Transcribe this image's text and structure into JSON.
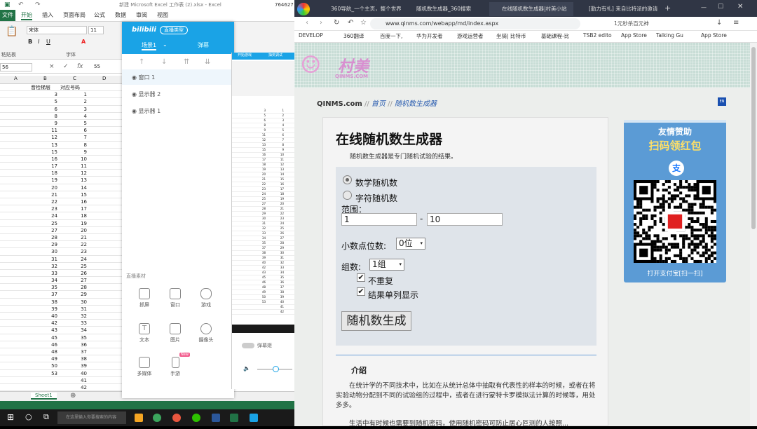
{
  "excel": {
    "title": "新建 Microsoft Excel 工作表 (2).xlsx - Excel",
    "title_right": "764627",
    "tabs": [
      "文件",
      "开始",
      "插入",
      "页面布局",
      "公式",
      "数据",
      "审阅",
      "视图"
    ],
    "font_name": "宋体",
    "font_size": "11",
    "ribbon_groups": [
      "粘贴板",
      "字体"
    ],
    "cell_ref": "56",
    "formula_value": "55",
    "formula_icons": [
      "×",
      "✓",
      "fx"
    ],
    "col_headers": [
      "A",
      "B",
      "C",
      "D"
    ],
    "header_b": "音检梯层",
    "header_c": "对应号码",
    "col_b": [
      "3",
      "5",
      "6",
      "8",
      "9",
      "11",
      "12",
      "13",
      "15",
      "16",
      "17",
      "18",
      "19",
      "20",
      "21",
      "22",
      "23",
      "24",
      "25",
      "27",
      "28",
      "29",
      "30",
      "31",
      "32",
      "33",
      "34",
      "35",
      "37",
      "38",
      "39",
      "40",
      "42",
      "43",
      "45",
      "46",
      "48",
      "49",
      "50",
      "53"
    ],
    "col_c": [
      "1",
      "2",
      "3",
      "4",
      "5",
      "6",
      "7",
      "8",
      "9",
      "10",
      "11",
      "12",
      "13",
      "14",
      "15",
      "16",
      "17",
      "18",
      "19",
      "20",
      "21",
      "22",
      "23",
      "24",
      "25",
      "26",
      "27",
      "28",
      "29",
      "30",
      "31",
      "32",
      "33",
      "34",
      "35",
      "36",
      "37",
      "38",
      "39",
      "40",
      "41",
      "42"
    ],
    "sheet_tab": "Sheet1",
    "status_color": "#217346"
  },
  "obs": {
    "logo": "bilibili",
    "live_type": "直播类型",
    "scene_tab": "场景1",
    "tab2": "弹幕",
    "sources": [
      "窗口 1",
      "显示器 2",
      "显示器 1"
    ],
    "materials_title": "直播素材",
    "materials": [
      "抓屏",
      "窗口",
      "游戏",
      "文本",
      "图片",
      "摄像头",
      "多媒体",
      "手游"
    ],
    "new_badge": "New",
    "toggle_label": "弹幕姬",
    "preview_tabs": [
      "开始游戏",
      "抽奖调试"
    ]
  },
  "browser": {
    "tabs": [
      "360导航_一个主页，整个世界",
      "随机数生成器_360搜索",
      "在线随机数生成器|村美小站",
      "[勤力有礼] 来自比特派的邀请"
    ],
    "url": "www.qinms.com/webapp/md/index.aspx",
    "search_hint": "1元秒杀百元神",
    "bookmarks": [
      "DEVELOP",
      "360翻译",
      "百度一下,",
      "华为开发者",
      "游戏运营者",
      "坐骑| 比特币",
      "基础课程-比",
      "TSB2 edito",
      "App Store",
      "Talking Gu",
      "App Store"
    ]
  },
  "page": {
    "logo_text": "村美",
    "logo_sub": "QINMS.COM",
    "site": "QINMS.com",
    "crumb_sep": "//",
    "crumb_home": "首页",
    "crumb_current": "随机数生成器",
    "lang_badge": "EN",
    "heading": "在线随机数生成器",
    "subheading": "随机数生成器是专门随机试验的结果。",
    "radio_number": "数学随机数",
    "radio_char": "字符随机数",
    "range_label": "范围：",
    "range_from": "1",
    "range_dash": "-",
    "range_to": "10",
    "decimal_label": "小数点位数:",
    "decimal_value": "0位",
    "groups_label": "组数:",
    "groups_value": "1组",
    "no_repeat": "不重复",
    "single_col": "结果单列显示",
    "generate_btn": "随机数生成",
    "intro_title": "介绍",
    "intro_p1": "在统计学的不同技术中，比如在从统计总体中抽取有代表性的样本的时候，或者在将实验动物分配到不同的试验组的过程中，或者在进行蒙特卡罗模拟法计算的时候等，用处多多。",
    "intro_p2": "生活中有时候也需要到随机密码，使用随机密码可防止居心叵测的人按照...",
    "side_title": "友情赞助",
    "side_sub": "扫码领红包",
    "side_bottom": "打开支付宝[扫一扫]",
    "side_logo": "支"
  },
  "taskbar": {
    "search_placeholder": "在这里输入你要搜索的内容"
  }
}
